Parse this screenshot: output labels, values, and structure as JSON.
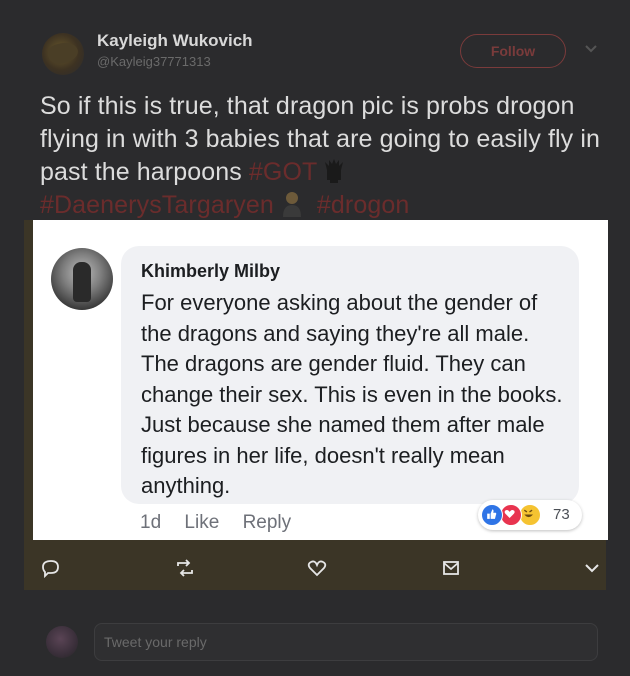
{
  "tweet": {
    "author_name": "Kayleigh Wukovich",
    "author_handle": "@Kayleig37771313",
    "follow_label": "Follow",
    "text_main": "So if this is true, that dragon pic is probs drogon flying in with 3 babies that are going to easily fly in past the harpoons",
    "hashtags": [
      "#GOT",
      "#DaenerysTargaryen",
      "#drogon"
    ],
    "icons": [
      "iron-throne-icon",
      "woman-emoji-icon"
    ]
  },
  "embedded_comment": {
    "name": "Khimberly Milby",
    "text": "For everyone asking about the gender of the dragons and saying they're all male. The dragons are gender fluid. They can change their sex. This is even in the books. Just because she named them after male figures in her life, doesn't really mean anything.",
    "age": "1d",
    "like_label": "Like",
    "reply_label": "Reply",
    "reactions": [
      "like",
      "love",
      "haha"
    ],
    "reaction_count": "73",
    "colors": {
      "like": "#2f74e6",
      "love": "#e8344f",
      "haha": "#f5c331"
    }
  },
  "actions": [
    "reply-icon",
    "retweet-icon",
    "like-icon",
    "message-icon",
    "more-icon"
  ],
  "reply_bar": {
    "placeholder": "Tweet your reply"
  },
  "colors": {
    "background": "#2b2b2d",
    "hashtag": "#6b2c2c",
    "follow": "#7a3b3b"
  }
}
